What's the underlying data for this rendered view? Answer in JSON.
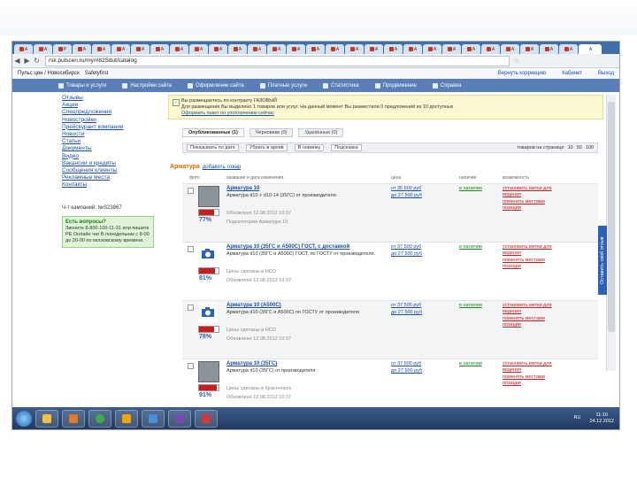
{
  "browser": {
    "tab_labels": [
      "A",
      "A",
      "P",
      "A",
      "A",
      "A",
      "A",
      "A",
      "A",
      "A",
      "A",
      "A",
      "A",
      "A",
      "A",
      "A",
      "A",
      "A",
      "A",
      "A",
      "A",
      "A",
      "A",
      "A",
      "A",
      "A",
      "A",
      "A",
      "A"
    ],
    "active_tab_label": "A",
    "url": "rsk.pulscen.ru/my/#82Sdut/catalog"
  },
  "bookmarks": {
    "left": [
      "Пульс цен / Новосибирск",
      "Safetyfirst"
    ],
    "right": [
      "Вернуть коррекцию",
      "Кабинет",
      "Выход"
    ]
  },
  "top_menu": [
    "Товары и услуги",
    "Настройки сайта",
    "Оформление сайта",
    "Платные услуги",
    "Статистика",
    "Продвижение",
    "Справка"
  ],
  "sidebar": {
    "links": [
      "Отзывы",
      "Акции",
      "Спецпредложения",
      "Новостройки",
      "Прейскурант компании",
      "Новости",
      "Статьи",
      "Документы",
      "Видео",
      "Вакансии и кредиты",
      "Сообщения клиенты",
      "Рекламные места",
      "Контакты"
    ],
    "counter": "Ч-т кампаний: №S23867",
    "question_title": "Есть вопросы?",
    "question_text": "Звоните 8-800-100-11-31 или пишите РЕ Онлайн чат В понедельник с 8-00 до 20-00 по московскому времени."
  },
  "notice": {
    "line1": "Вы размещаетесь по контракту ГАЗОВЫЙ",
    "line2": "Для размещения Вы выделено 1 товаров или услуг. На данный момент Вы разместили 0 предложений из 10 доступных",
    "link": "Оформить пакет по упоплачению сейчас"
  },
  "subtabs": [
    "Опубликованные (1)",
    "Черновики (0)",
    "Удалённые (0)"
  ],
  "filter": {
    "buttons": [
      "Показывать по дате",
      "Убрать в архив",
      "В новинку",
      "Подсказка"
    ],
    "per_page_label": "товаров на странице",
    "per_page": [
      "10",
      "50",
      "100"
    ]
  },
  "section": {
    "title": "Арматура",
    "link": "добавить товар"
  },
  "columns": [
    "фото",
    "название и дата изменения",
    "цена",
    "наличие",
    "возможность"
  ],
  "rows": [
    {
      "name": "Арматура 10",
      "desc": "Арматура d10 + d10-14 (35ГС) от производителя.",
      "meta1": "Обновлено 12.08.2012 10:37",
      "meta2": "Подкатегория Арматура 10",
      "price1": "от 35 500 руб",
      "price2": "до 27 500 руб",
      "stock": "в наличии",
      "actions": [
        "установить метки для",
        "ведения",
        "поменять местами",
        "позиции"
      ],
      "percent": "77%",
      "fill": 0.77
    },
    {
      "name": "Арматура 10 (35ГС и А500С) ГОСТ, с доставкой",
      "desc": "Арматура d10 (35ГС и А500С) ГОСТ, по ГОСТУ от производителя.",
      "meta1": "Цены сделаны в НСО",
      "meta2": "Обновлено 12.08.2012 10:37",
      "price1": "от 37 500 руб",
      "price2": "до 27 500 руб",
      "stock": "в наличии",
      "actions": [
        "установить метки для",
        "ведения",
        "поменять местами",
        "позиции"
      ],
      "percent": "81%",
      "fill": 0.81
    },
    {
      "name": "Арматура 10 (А500С)",
      "desc": "Арматура d10 (35ГС и А500С) по ГОСТУ от производителя",
      "meta1": "Цены сделаны в НСО",
      "meta2": "Обновлено 12.08.2012 10:37",
      "price1": "от 37 500 руб",
      "price2": "до 27 500 руб",
      "stock": "в наличии",
      "actions": [
        "установить метки для",
        "ведения",
        "поменять местами",
        "позиции"
      ],
      "percent": "78%",
      "fill": 0.78
    },
    {
      "name": "Арматура 10 (35ГС)",
      "desc": "Арматура d10 (35ГС) от производителя",
      "meta1": "Цены сделаны в Красноярск",
      "meta2": "Обновлено 12.08.2012 10:37",
      "price1": "от 37 500 руб",
      "price2": "до 27 500 руб",
      "stock": "в наличии",
      "actions": [
        "установить метки для",
        "ведения",
        "поменять местами",
        "позиции"
      ],
      "percent": "91%",
      "fill": 0.91
    }
  ],
  "feedback_label": "Оставить свой отзыв",
  "taskbar": {
    "lang": "RU",
    "time": "11:10",
    "date": "24.12.2012"
  },
  "colors": {
    "menu": "#5a7fb7",
    "link": "#1a4fa8",
    "accent": "#d66b00",
    "danger": "#cc1b1b"
  }
}
